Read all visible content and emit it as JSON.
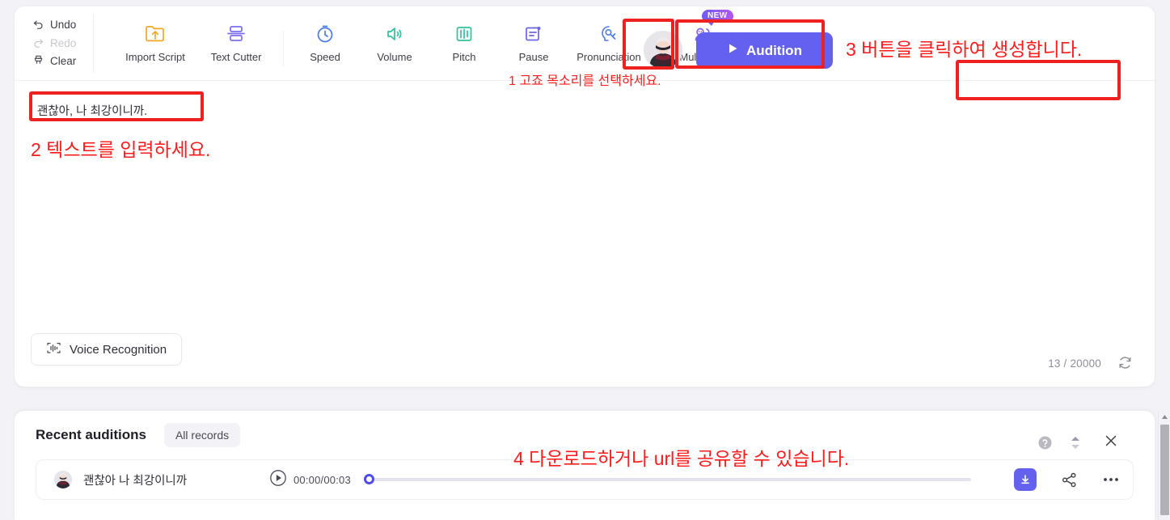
{
  "toolbar": {
    "history": [
      {
        "label": "Undo",
        "icon": "undo-icon",
        "enabled": true
      },
      {
        "label": "Redo",
        "icon": "redo-icon",
        "enabled": false
      },
      {
        "label": "Clear",
        "icon": "brush-icon",
        "enabled": true
      }
    ],
    "tools": [
      {
        "label": "Import Script",
        "icon": "folder-upload-icon"
      },
      {
        "label": "Text Cutter",
        "icon": "text-cutter-icon"
      },
      {
        "label": "Speed",
        "icon": "speed-icon"
      },
      {
        "label": "Volume",
        "icon": "volume-icon"
      },
      {
        "label": "Pitch",
        "icon": "pitch-icon"
      },
      {
        "label": "Pause",
        "icon": "pause-doc-icon"
      },
      {
        "label": "Pronunciation",
        "icon": "pronunciation-icon"
      },
      {
        "label": "MultiVoice",
        "icon": "multivoice-icon",
        "badge": "NEW"
      }
    ],
    "audition_label": "Audition"
  },
  "editor": {
    "script_value": "괜찮아, 나 최강이니까.",
    "script_placeholder": "괜찮아, 나 최강이니까.",
    "voice_recognition_label": "Voice Recognition",
    "char_count": "13 / 20000"
  },
  "panel": {
    "title": "Recent auditions",
    "all_records_label": "All records",
    "rows": [
      {
        "title": "괜찮아 나 최강이니까",
        "time": "00:00/00:03",
        "progress_percent": 0
      }
    ]
  },
  "annotations": [
    {
      "id": "anno-1",
      "text": "1 고죠 목소리를 선택하세요."
    },
    {
      "id": "anno-2",
      "text": "2 텍스트를 입력하세요."
    },
    {
      "id": "anno-3",
      "text": "3 버튼을 클릭하여 생성합니다."
    },
    {
      "id": "anno-4",
      "text": "4 다운로드하거나 url를 공유할 수 있습니다."
    }
  ],
  "colors": {
    "accent": "#6461f0",
    "annotation_red": "#ff1a1a",
    "highlight_box": "#ef2020",
    "page_bg": "#f3f3f7"
  }
}
